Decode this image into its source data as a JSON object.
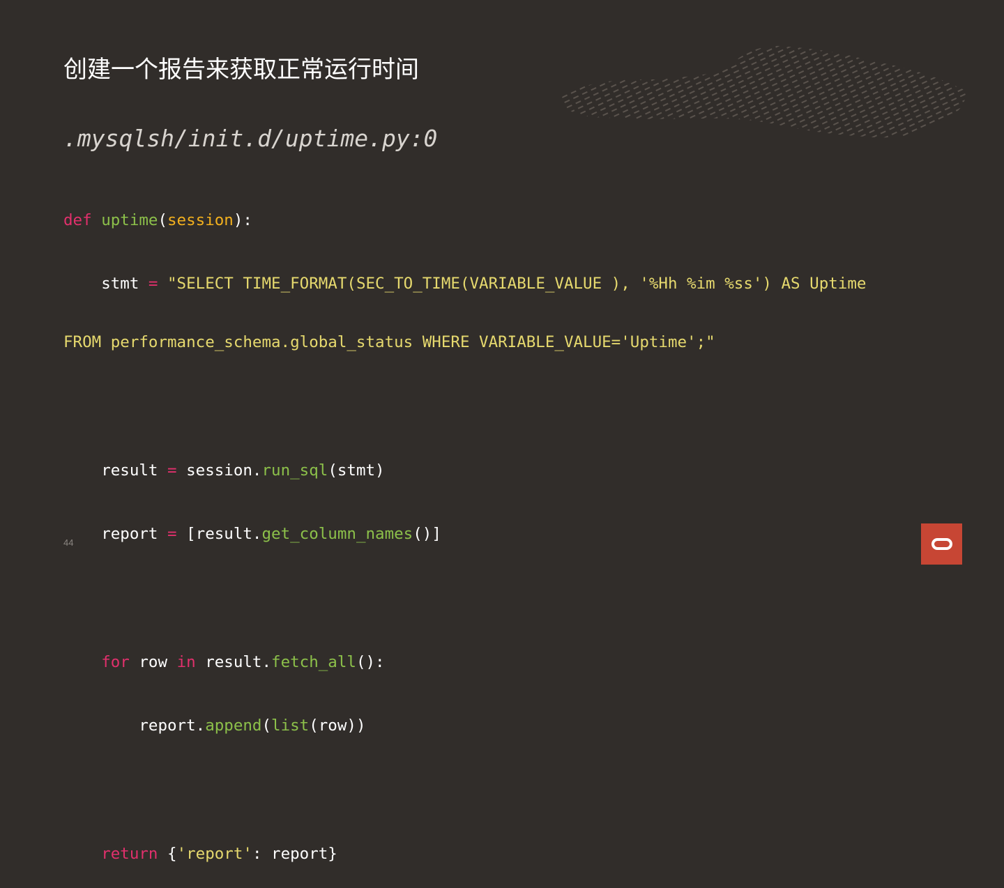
{
  "slide": {
    "title": "创建一个报告来获取正常运行时间",
    "subtitle": ".mysqlsh/init.d/uptime.py:0",
    "page_number": "44"
  },
  "code": {
    "def_kw": "def",
    "func_name": "uptime",
    "open_paren": "(",
    "param": "session",
    "close_colon": "):",
    "indent1": "    ",
    "indent2": "        ",
    "stmt_var": "stmt",
    "assign": "=",
    "sql_line1": "\"SELECT TIME_FORMAT(SEC_TO_TIME(VARIABLE_VALUE ), '%Hh %im %ss') AS Uptime",
    "sql_line2": "FROM performance_schema.global_status WHERE VARIABLE_VALUE='Uptime';\"",
    "result_var": "result",
    "session_ref": "session.",
    "run_sql": "run_sql",
    "run_sql_args": "(stmt)",
    "report_var": "report",
    "report_open": "[result.",
    "get_column_names": "get_column_names",
    "report_close": "()]",
    "for_kw": "for",
    "row_var": "row",
    "in_kw": "in",
    "result_ref": "result.",
    "fetch_all": "fetch_all",
    "fetch_close": "():",
    "report_ref": "report.",
    "append": "append",
    "list_fn": "list",
    "row_arg": "(row))",
    "return_kw": "return",
    "dict_open": "{",
    "report_key": "'report'",
    "dict_rest": ": report}"
  },
  "colors": {
    "background": "#312d2a",
    "keyword": "#e1306c",
    "function": "#8cc04a",
    "parameter": "#f2b01e",
    "string": "#e6d96e",
    "logo": "#c74634"
  },
  "icons": {
    "brand_logo": "oracle-logo-icon",
    "decor": "leaf-texture-decoration"
  }
}
